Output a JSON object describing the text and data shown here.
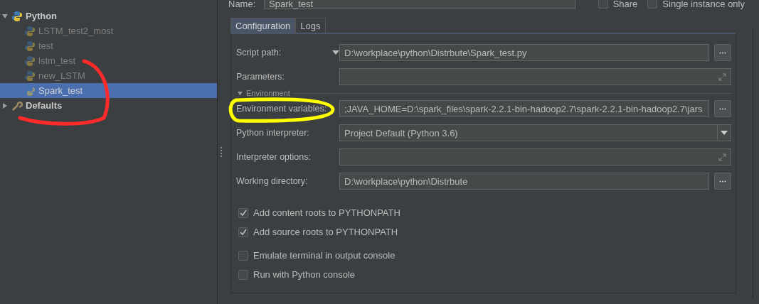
{
  "tree": [
    {
      "label": "Python",
      "kind": "folder",
      "expanded": true,
      "children": [
        {
          "label": "LSTM_test2_most",
          "temporary": true,
          "selected": false
        },
        {
          "label": "test",
          "temporary": true,
          "selected": false
        },
        {
          "label": "lstm_test",
          "temporary": true,
          "selected": false
        },
        {
          "label": "new_LSTM",
          "temporary": true,
          "selected": false
        },
        {
          "label": "Spark_test",
          "temporary": true,
          "selected": true
        }
      ]
    },
    {
      "label": "Defaults",
      "kind": "defaults",
      "expanded": false
    }
  ],
  "name_field": {
    "label": "Name:",
    "value": "Spark_test"
  },
  "header_checks": [
    {
      "label": "Share",
      "checked": false
    },
    {
      "label": "Single instance only",
      "checked": false
    }
  ],
  "tabs": [
    {
      "label": "Configuration",
      "selected": true
    },
    {
      "label": "Logs",
      "selected": false
    }
  ],
  "fields": [
    {
      "label": "Script path:",
      "kind": "path",
      "value": "D:\\workplace\\python\\Distrbute\\Spark_test.py",
      "dropdown": true
    },
    {
      "label": "Parameters:",
      "kind": "expand"
    },
    {
      "kind": "section",
      "label": "Environment",
      "expanded": true
    },
    {
      "label": "Environment variables:",
      "kind": "path",
      "value": ";JAVA_HOME=D:\\spark_files\\spark-2.2.1-bin-hadoop2.7\\spark-2.2.1-bin-hadoop2.7\\jars"
    },
    {
      "label": "Python interpreter:",
      "kind": "combo",
      "value": "Project Default (Python 3.6)"
    },
    {
      "label": "Interpreter options:",
      "kind": "expand"
    },
    {
      "label": "Working directory:",
      "kind": "path",
      "value": "D:\\workplace\\python\\Distrbute"
    }
  ],
  "options": [
    {
      "label": "Add content roots to PYTHONPATH",
      "checked": true
    },
    {
      "label": "Add source roots to PYTHONPATH",
      "checked": true
    },
    {
      "label": "Emulate terminal in output console",
      "checked": false
    },
    {
      "label": "Run with Python console",
      "checked": false
    }
  ],
  "annotations": [
    {
      "kind": "left",
      "color": "#ff2a2a"
    },
    {
      "kind": "right",
      "color": "#ffff00"
    }
  ]
}
